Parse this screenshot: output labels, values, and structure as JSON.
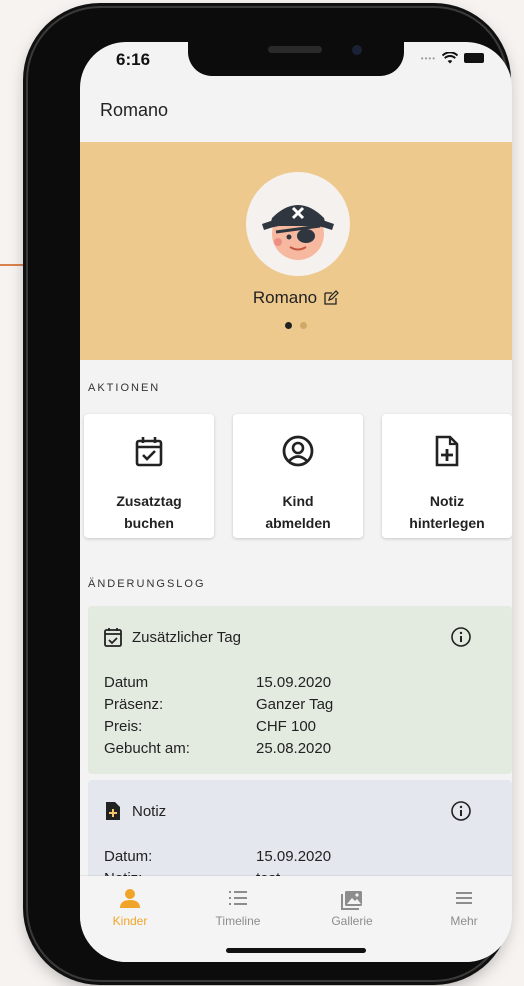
{
  "status": {
    "time": "6:16"
  },
  "header": {
    "title": "Romano"
  },
  "profile": {
    "name": "Romano",
    "pages": 2,
    "active_page": 1
  },
  "actions": {
    "section_label": "AKTIONEN",
    "items": [
      {
        "line1": "Zusatztag",
        "line2": "buchen",
        "icon": "calendar-check-icon"
      },
      {
        "line1": "Kind",
        "line2": "abmelden",
        "icon": "person-circle-icon"
      },
      {
        "line1": "Notiz",
        "line2": "hinterlegen",
        "icon": "note-add-icon"
      }
    ]
  },
  "log": {
    "section_label": "ÄNDERUNGSLOG",
    "entries": [
      {
        "title": "Zusätzlicher Tag",
        "icon": "calendar-check-icon",
        "color": "#e3ebe1",
        "rows": [
          {
            "label": "Datum",
            "value": "15.09.2020"
          },
          {
            "label": "Präsenz:",
            "value": "Ganzer Tag"
          },
          {
            "label": "Preis:",
            "value": "CHF 100"
          },
          {
            "label": "Gebucht am:",
            "value": "25.08.2020"
          }
        ]
      },
      {
        "title": "Notiz",
        "icon": "note-add-icon",
        "color": "#e4e8ee",
        "rows": [
          {
            "label": "Datum:",
            "value": "15.09.2020"
          },
          {
            "label": "Notiz:",
            "value": "test"
          }
        ]
      }
    ]
  },
  "tabs": [
    {
      "label": "Kinder",
      "icon": "person-icon",
      "active": true
    },
    {
      "label": "Timeline",
      "icon": "list-icon",
      "active": false
    },
    {
      "label": "Gallerie",
      "icon": "gallery-icon",
      "active": false
    },
    {
      "label": "Mehr",
      "icon": "menu-icon",
      "active": false
    }
  ],
  "colors": {
    "accent": "#f0a52a",
    "profile_bg": "#edc98d"
  }
}
